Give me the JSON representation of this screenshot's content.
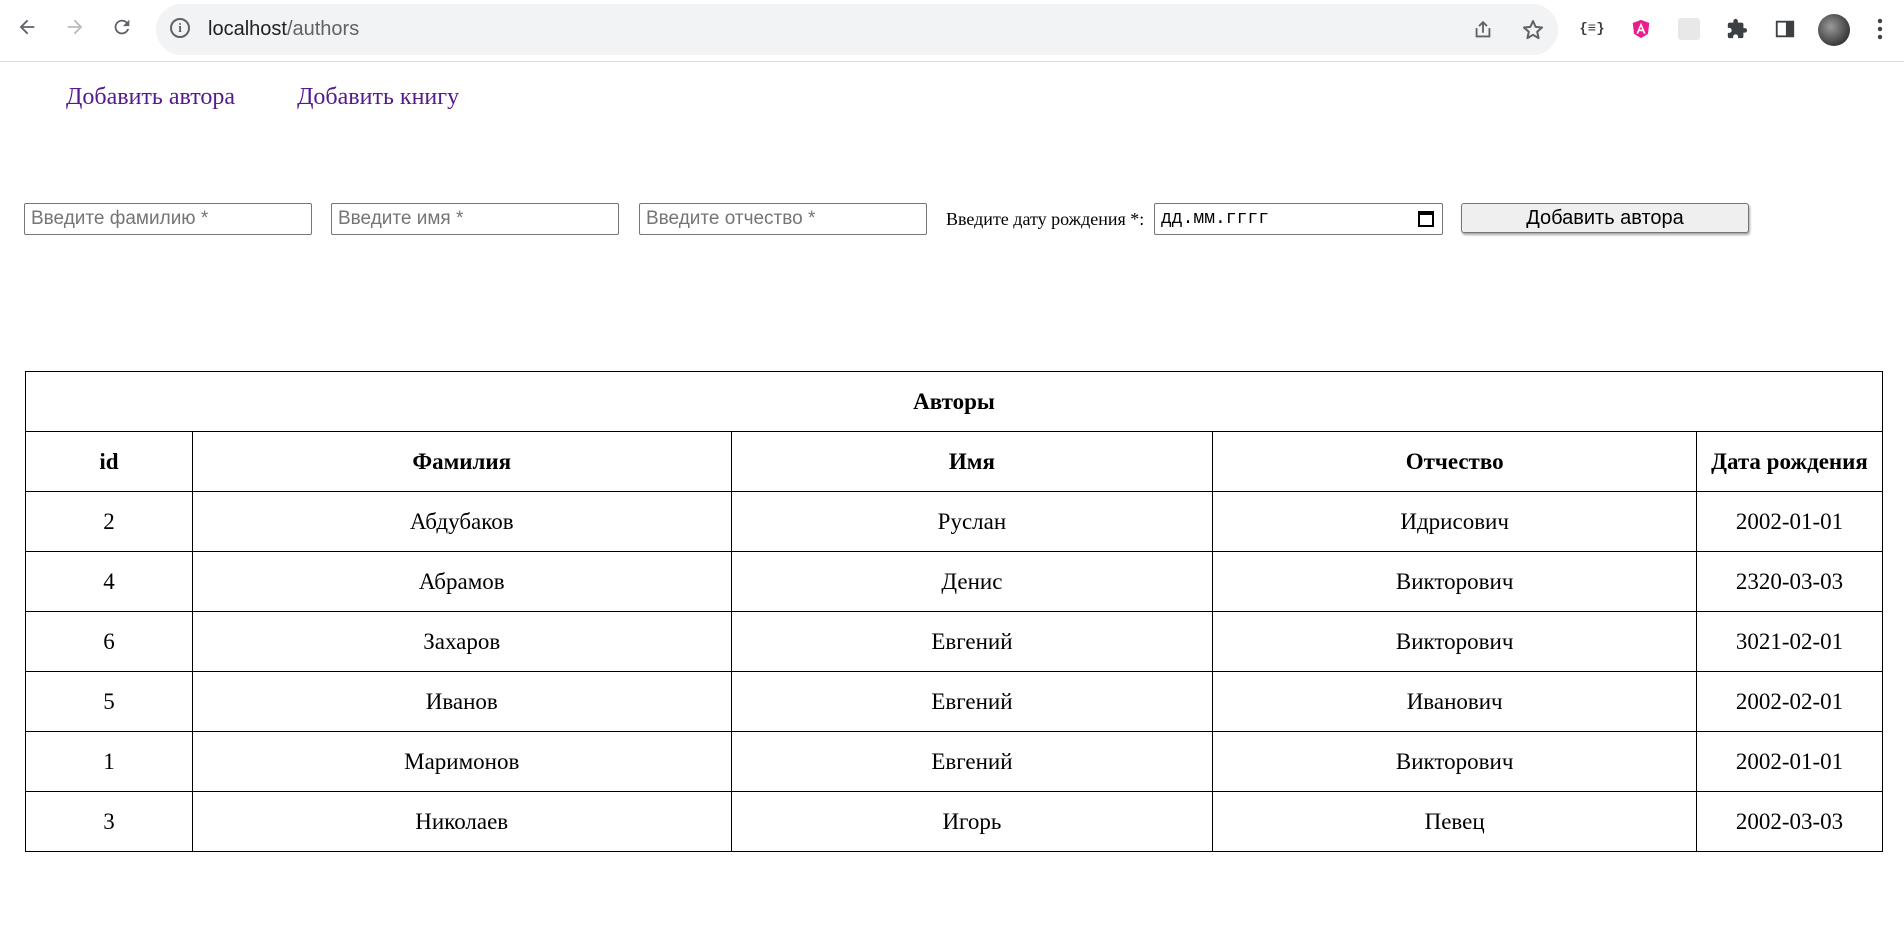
{
  "browser": {
    "url_host": "localhost",
    "url_path": "/authors"
  },
  "icons": {
    "back": "arrow-left-icon",
    "forward": "arrow-right-icon",
    "reload": "reload-icon",
    "info": "info-icon",
    "share": "share-icon",
    "bookmark": "star-icon",
    "extensions": "puzzle-icon",
    "sidepanel": "side-panel-icon",
    "menu": "kebab-menu-icon"
  },
  "nav": {
    "add_author": "Добавить автора",
    "add_book": "Добавить книгу"
  },
  "form": {
    "last_name_placeholder": "Введите фамилию *",
    "first_name_placeholder": "Введите имя *",
    "patronymic_placeholder": "Введите отчество *",
    "date_label": "Введите дату рождения *:",
    "date_placeholder": "дд.мм.гггг",
    "submit_label": "Добавить автора"
  },
  "table": {
    "caption": "Авторы",
    "headers": [
      "id",
      "Фамилия",
      "Имя",
      "Отчество",
      "Дата рождения"
    ],
    "rows": [
      [
        "2",
        "Абдубаков",
        "Руслан",
        "Идрисович",
        "2002-01-01"
      ],
      [
        "4",
        "Абрамов",
        "Денис",
        "Викторович",
        "2320-03-03"
      ],
      [
        "6",
        "Захаров",
        "Евгений",
        "Викторович",
        "3021-02-01"
      ],
      [
        "5",
        "Иванов",
        "Евгений",
        "Иванович",
        "2002-02-01"
      ],
      [
        "1",
        "Маримонов",
        "Евгений",
        "Викторович",
        "2002-01-01"
      ],
      [
        "3",
        "Николаев",
        "Игорь",
        "Певец",
        "2002-03-03"
      ]
    ]
  }
}
